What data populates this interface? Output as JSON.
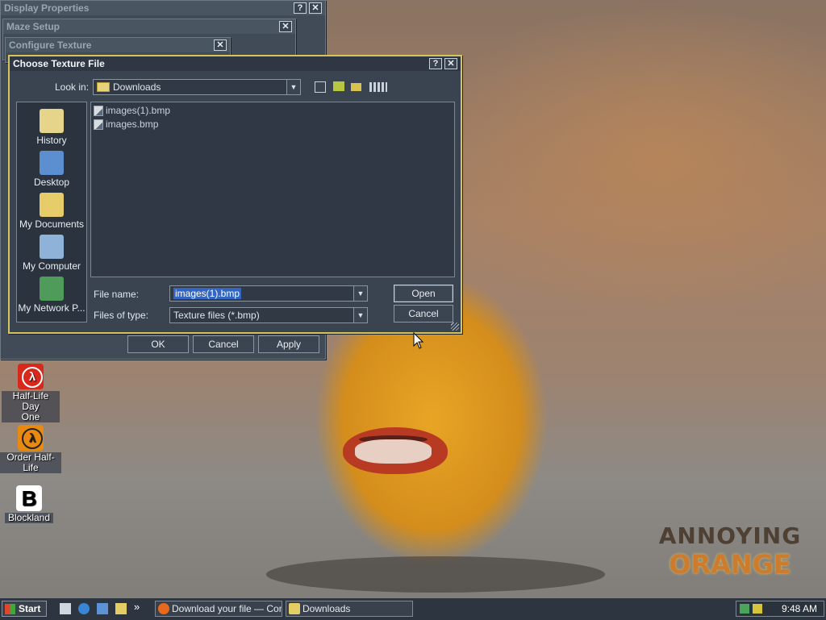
{
  "windows": {
    "display_properties": {
      "title": "Display Properties"
    },
    "maze_setup": {
      "title": "Maze Setup"
    },
    "configure_texture": {
      "title": "Configure Texture"
    },
    "choose_texture": {
      "title": "Choose Texture File",
      "look_in_label": "Look in:",
      "look_in_value": "Downloads",
      "places": [
        "History",
        "Desktop",
        "My Documents",
        "My Computer",
        "My Network P..."
      ],
      "files": [
        "images(1).bmp",
        "images.bmp"
      ],
      "file_name_label": "File name:",
      "file_name_value": "images(1).bmp",
      "files_of_type_label": "Files of type:",
      "files_of_type_value": "Texture files (*.bmp)",
      "open_label": "Open",
      "cancel_label": "Cancel"
    }
  },
  "display_buttons": {
    "ok": "OK",
    "cancel": "Cancel",
    "apply": "Apply"
  },
  "title_buttons": {
    "help": "?",
    "close": "✕"
  },
  "desktop_icons": [
    {
      "label_line1": "Half-Life Day",
      "label_line2": "One"
    },
    {
      "label_line1": "Order Half-Life"
    },
    {
      "label_line1": "Blockland"
    }
  ],
  "watermark": {
    "line1": "ANNOYING",
    "line2": "ORANGE"
  },
  "taskbar": {
    "start_label": "Start",
    "tasks": [
      "Download your file — Con...",
      "Downloads"
    ],
    "clock": "9:48 AM",
    "more": "»"
  },
  "colors": {
    "selection": "#3266c2",
    "window_bg": "#3a4350",
    "accent": "#d5c45a"
  }
}
